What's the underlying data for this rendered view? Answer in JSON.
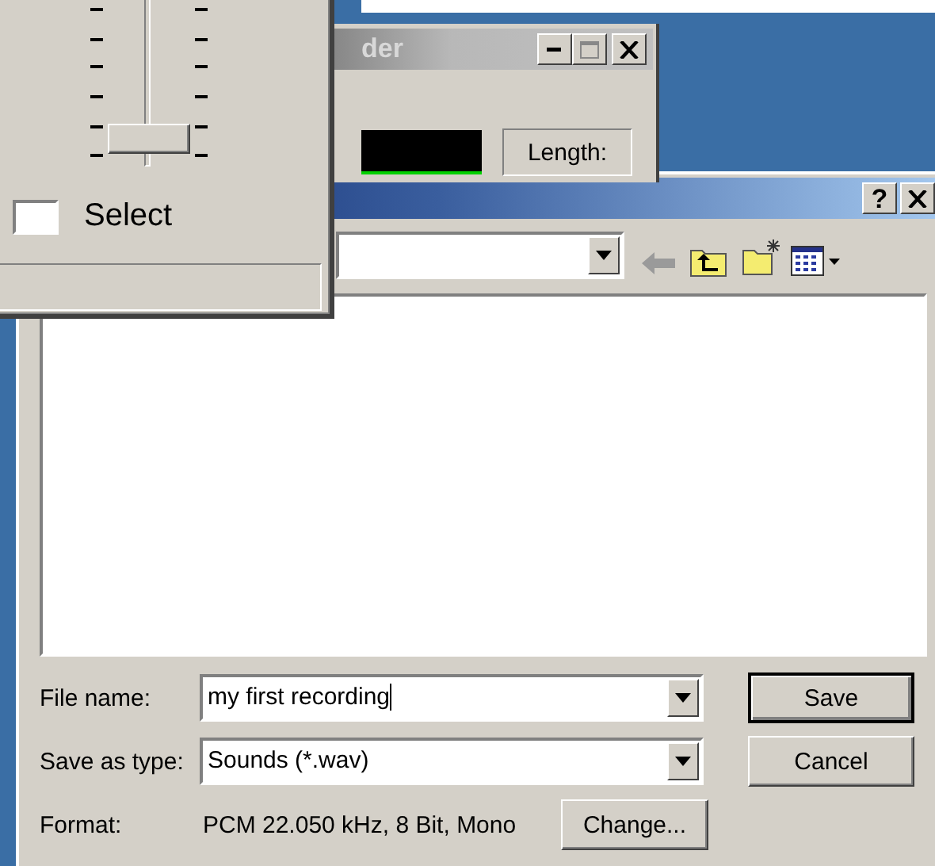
{
  "volume_window": {
    "slider": {
      "level": 0.08
    },
    "checkbox": {
      "label": "Select",
      "checked": false
    }
  },
  "recorder_window": {
    "title": "der",
    "length_label": "Length:"
  },
  "save_dialog": {
    "help_button": "?",
    "file_name": {
      "label": "File name:",
      "value": "my first recording"
    },
    "save_as_type": {
      "label": "Save as type:",
      "value": "Sounds (*.wav)"
    },
    "format": {
      "label": "Format:",
      "value": "PCM 22.050 kHz, 8 Bit, Mono"
    },
    "buttons": [
      {
        "label": "Save",
        "default": true
      },
      {
        "label": "Cancel",
        "default": false
      }
    ],
    "change_button": "Change..."
  }
}
